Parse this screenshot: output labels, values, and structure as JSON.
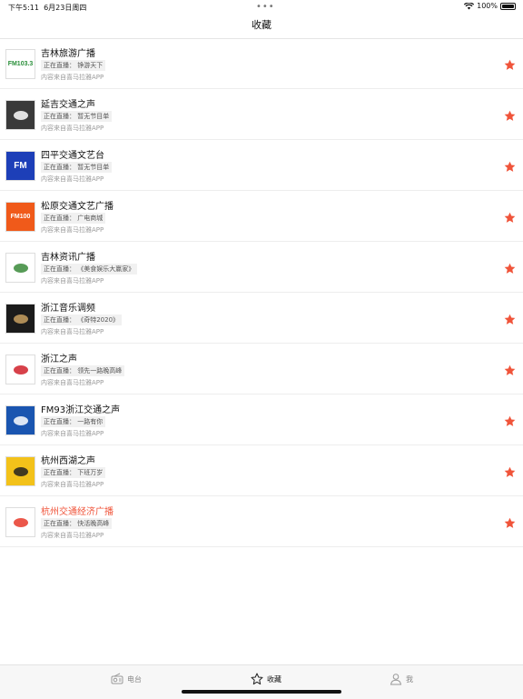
{
  "status": {
    "time": "下午5:11",
    "date": "6月23日周四",
    "battery": "100%",
    "battery_level": 1.0
  },
  "nav": {
    "title": "收藏"
  },
  "stations": [
    {
      "name": "吉林旅游广播",
      "live": "正在直播：  铮游天下",
      "source": "内容来自喜马拉雅APP",
      "logo_text": "FM103.3",
      "logo_bg": "#ffffff",
      "logo_fg": "#2a8f3a",
      "active": false
    },
    {
      "name": "延吉交通之声",
      "live": "正在直播：  暂无节目单",
      "source": "内容来自喜马拉雅APP",
      "logo_text": "",
      "logo_bg": "#3a3a3a",
      "logo_fg": "#ffffff",
      "active": false
    },
    {
      "name": "四平交通文艺台",
      "live": "正在直播：  暂无节目单",
      "source": "内容来自喜马拉雅APP",
      "logo_text": "FM",
      "logo_bg": "#1d3fb8",
      "logo_fg": "#ffffff",
      "active": false
    },
    {
      "name": "松原交通文艺广播",
      "live": "正在直播：  广电商城",
      "source": "内容来自喜马拉雅APP",
      "logo_text": "FM100",
      "logo_bg": "#f05a1a",
      "logo_fg": "#ffffff",
      "active": false
    },
    {
      "name": "吉林资讯广播",
      "live": "正在直播：  《美食娱乐大赢家》",
      "source": "内容来自喜马拉雅APP",
      "logo_text": "",
      "logo_bg": "#ffffff",
      "logo_fg": "#3a8a3a",
      "active": false
    },
    {
      "name": "浙江音乐调频",
      "live": "正在直播：  《奇特2020》",
      "source": "内容来自喜马拉雅APP",
      "logo_text": "",
      "logo_bg": "#1b1b1b",
      "logo_fg": "#c8a060",
      "active": false
    },
    {
      "name": "浙江之声",
      "live": "正在直播：  领先一路晚高峰",
      "source": "内容来自喜马拉雅APP",
      "logo_text": "",
      "logo_bg": "#ffffff",
      "logo_fg": "#d0202a",
      "active": false
    },
    {
      "name": "FM93浙江交通之声",
      "live": "正在直播：  一路有你",
      "source": "内容来自喜马拉雅APP",
      "logo_text": "",
      "logo_bg": "#1a55b0",
      "logo_fg": "#ffffff",
      "active": false
    },
    {
      "name": "杭州西湖之声",
      "live": "正在直播：  下班万岁",
      "source": "内容来自喜马拉雅APP",
      "logo_text": "",
      "logo_bg": "#f3c21a",
      "logo_fg": "#222222",
      "active": false
    },
    {
      "name": "杭州交通经济广播",
      "live": "正在直播：  快活晚高峰",
      "source": "内容来自喜马拉雅APP",
      "logo_text": "",
      "logo_bg": "#ffffff",
      "logo_fg": "#e83a2a",
      "active": true
    }
  ],
  "tabs": [
    {
      "label": "电台",
      "icon": "radio-icon",
      "active": false
    },
    {
      "label": "收藏",
      "icon": "star-outline-icon",
      "active": true
    },
    {
      "label": "我",
      "icon": "person-icon",
      "active": false
    }
  ],
  "colors": {
    "accent": "#f0543a",
    "star": "#f0543a"
  }
}
